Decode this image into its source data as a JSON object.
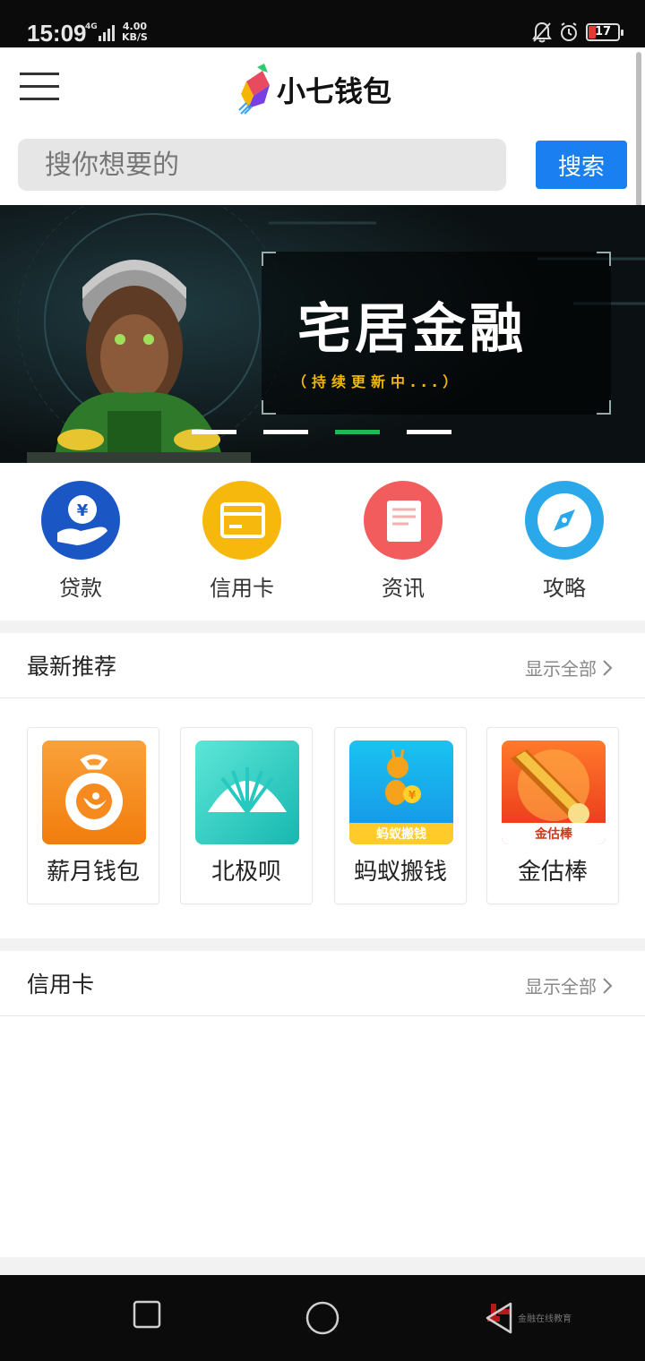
{
  "status": {
    "time": "15:09",
    "network": "4G",
    "speed_value": "4.00",
    "speed_unit": "KB/S",
    "battery": "17"
  },
  "header": {
    "app_name": "小七钱包"
  },
  "search": {
    "placeholder": "搜你想要的",
    "button_label": "搜索"
  },
  "banner": {
    "title": "宅居金融",
    "subtitle": "（持续更新中...）",
    "slide_count": 4,
    "active_index": 2
  },
  "categories": [
    {
      "label": "贷款",
      "color": "#1a56c4",
      "icon": "loan-icon"
    },
    {
      "label": "信用卡",
      "color": "#f7b80e",
      "icon": "credit-card-icon"
    },
    {
      "label": "资讯",
      "color": "#f25c5c",
      "icon": "news-icon"
    },
    {
      "label": "攻略",
      "color": "#2ba8ea",
      "icon": "compass-icon"
    }
  ],
  "recommend": {
    "title": "最新推荐",
    "show_all": "显示全部",
    "apps": [
      {
        "name": "薪月钱包",
        "icon": "moon-wallet-icon",
        "color": "#f78a1e"
      },
      {
        "name": "北极呗",
        "icon": "shell-icon",
        "color": "#27c8c0"
      },
      {
        "name": "蚂蚁搬钱",
        "icon": "ant-icon",
        "color": "#22a9f0",
        "badge": "蚂蚁搬钱"
      },
      {
        "name": "金估棒",
        "icon": "gold-stick-icon",
        "color": "#f24e1e",
        "badge": "金估棒"
      }
    ]
  },
  "credit": {
    "title": "信用卡",
    "show_all": "显示全部"
  },
  "watermark": {
    "text": "金融在线教育"
  }
}
